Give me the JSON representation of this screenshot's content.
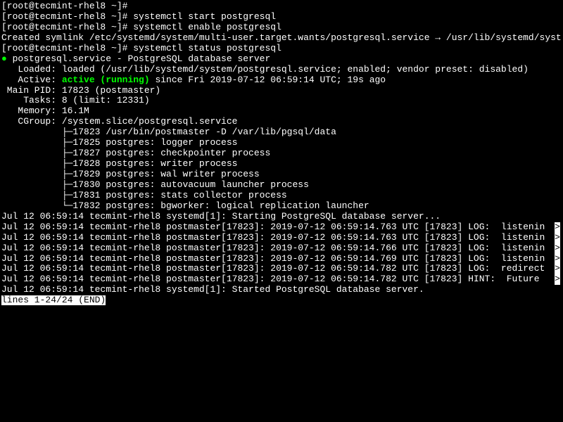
{
  "prompt1": "[root@tecmint-rhel8 ~]# ",
  "cmd1": "systemctl start postgresql",
  "cmd2": "systemctl enable postgresql",
  "symlink": "Created symlink /etc/systemd/system/multi-user.target.wants/postgresql.service → /usr/lib/systemd/system/postgresql.service.",
  "cmd3": "systemctl status postgresql",
  "bullet": "●",
  "service_title": " postgresql.service - PostgreSQL database server",
  "loaded": "   Loaded: loaded (/usr/lib/systemd/system/postgresql.service; enabled; vendor preset: disabled)",
  "active_label": "   Active: ",
  "active_status": "active (running)",
  "active_since": " since Fri 2019-07-12 06:59:14 UTC; 19s ago",
  "mainpid": " Main PID: 17823 (postmaster)",
  "tasks": "    Tasks: 8 (limit: 12331)",
  "memory": "   Memory: 16.1M",
  "cgroup": "   CGroup: /system.slice/postgresql.service",
  "proc1": "           ├─17823 /usr/bin/postmaster -D /var/lib/pgsql/data",
  "proc2": "           ├─17825 postgres: logger process   ",
  "proc3": "           ├─17827 postgres: checkpointer process   ",
  "proc4": "           ├─17828 postgres: writer process   ",
  "proc5": "           ├─17829 postgres: wal writer process   ",
  "proc6": "           ├─17830 postgres: autovacuum launcher process   ",
  "proc7": "           ├─17831 postgres: stats collector process   ",
  "proc8": "           └─17832 postgres: bgworker: logical replication launcher   ",
  "blank": "",
  "log1": "Jul 12 06:59:14 tecmint-rhel8 systemd[1]: Starting PostgreSQL database server...",
  "log2": "Jul 12 06:59:14 tecmint-rhel8 postmaster[17823]: 2019-07-12 06:59:14.763 UTC [17823] LOG:  listenin",
  "log3": "Jul 12 06:59:14 tecmint-rhel8 postmaster[17823]: 2019-07-12 06:59:14.763 UTC [17823] LOG:  listenin",
  "log4": "Jul 12 06:59:14 tecmint-rhel8 postmaster[17823]: 2019-07-12 06:59:14.766 UTC [17823] LOG:  listenin",
  "log5": "Jul 12 06:59:14 tecmint-rhel8 postmaster[17823]: 2019-07-12 06:59:14.769 UTC [17823] LOG:  listenin",
  "log6": "Jul 12 06:59:14 tecmint-rhel8 postmaster[17823]: 2019-07-12 06:59:14.782 UTC [17823] LOG:  redirect",
  "log7": "Jul 12 06:59:14 tecmint-rhel8 postmaster[17823]: 2019-07-12 06:59:14.782 UTC [17823] HINT:  Future ",
  "log8": "Jul 12 06:59:14 tecmint-rhel8 systemd[1]: Started PostgreSQL database server.",
  "pager": "lines 1-24/24 (END)",
  "arrow": ">"
}
